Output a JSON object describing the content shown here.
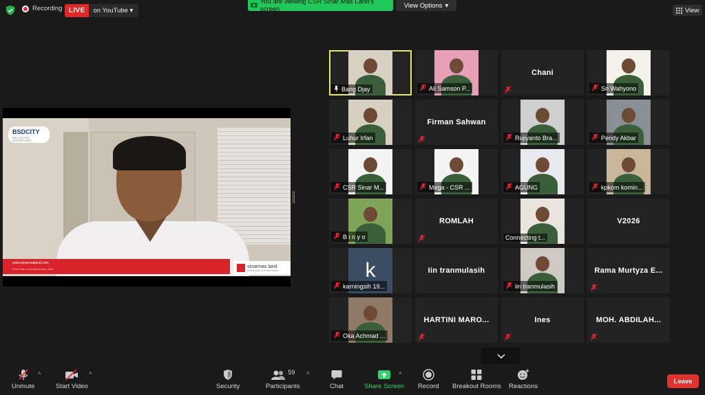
{
  "top": {
    "recording": "Recording",
    "live": "LIVE",
    "live_target": "on YouTube",
    "viewing": "You are viewing CSR Sinar Mas Land's screen",
    "view_options": "View Options",
    "view": "View"
  },
  "share": {
    "brand": "BSDCITY",
    "brand_sub": "BIG CITY BIG OPPORTUNITY",
    "site": "www.sinarmasland.com",
    "social": "Sinar Mas Land   @sinarmas_land",
    "logo": "sinarmas land",
    "logo_sub": "building for a better future"
  },
  "participants": [
    {
      "name": "Bang Djay",
      "mode": "video",
      "active": true,
      "muted": false,
      "pinned": true,
      "bg": "#d9d0c4"
    },
    {
      "name": "Ali Samson P...",
      "mode": "video",
      "muted": true,
      "bg": "#e8a0b8"
    },
    {
      "name": "Chani",
      "mode": "name",
      "muted": true
    },
    {
      "name": "Sri Wahyono",
      "mode": "video",
      "muted": true,
      "bg": "#f2f2e8"
    },
    {
      "name": "Luhur Irfan",
      "mode": "video",
      "muted": true,
      "bg": "#d7cfbf"
    },
    {
      "name": "Firman Sahwan",
      "mode": "name",
      "muted": true
    },
    {
      "name": "Rujiyanto Bra...",
      "mode": "video",
      "muted": true,
      "bg": "#cfcfcf"
    },
    {
      "name": "Pendy Akbar",
      "mode": "video",
      "muted": true,
      "bg": "#8a8f96"
    },
    {
      "name": "CSR Sinar M...",
      "mode": "video",
      "muted": true,
      "bg": "#f4f4f4"
    },
    {
      "name": "Mega - CSR ...",
      "mode": "video",
      "muted": true,
      "bg": "#f4f4f4"
    },
    {
      "name": "AGUNG",
      "mode": "video",
      "muted": true,
      "bg": "#e8e9ee"
    },
    {
      "name": "kpkom komin...",
      "mode": "video",
      "muted": true,
      "bg": "#c9b79c"
    },
    {
      "name": "B i n y o",
      "mode": "video",
      "muted": true,
      "bg": "#7fa45a"
    },
    {
      "name": "ROMLAH",
      "mode": "name",
      "muted": true
    },
    {
      "name": "Connecting t...",
      "mode": "video",
      "muted": false,
      "bg": "#e9e4de"
    },
    {
      "name": "V2026",
      "mode": "name",
      "muted": false
    },
    {
      "name": "karningsih 19...",
      "mode": "video",
      "muted": true,
      "bg": "#3b4d63",
      "letter": "k"
    },
    {
      "name": "Iin tranmulasih",
      "mode": "name",
      "muted": false
    },
    {
      "name": "iin tranmulasih",
      "mode": "video",
      "muted": true,
      "bg": "#cfc9c4"
    },
    {
      "name": "Rama Murtyza E...",
      "mode": "name",
      "muted": true
    },
    {
      "name": "Oka Achmad ...",
      "mode": "video",
      "muted": true,
      "bg": "#8e7a66"
    },
    {
      "name": "HARTINI MARO...",
      "mode": "name",
      "muted": true
    },
    {
      "name": "Ines",
      "mode": "name",
      "muted": true
    },
    {
      "name": "MOH. ABDILAH...",
      "mode": "name",
      "muted": true
    }
  ],
  "toolbar": {
    "unmute": "Unmute",
    "start_video": "Start Video",
    "security": "Security",
    "participants": "Participants",
    "participants_count": "59",
    "chat": "Chat",
    "share_screen": "Share Screen",
    "record": "Record",
    "breakout": "Breakout Rooms",
    "reactions": "Reactions",
    "leave": "Leave"
  }
}
